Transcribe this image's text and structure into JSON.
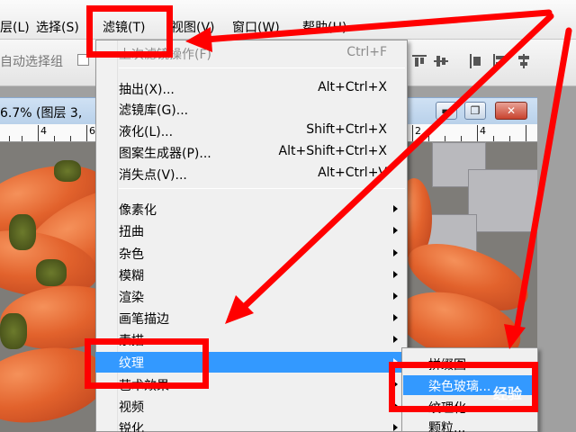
{
  "menubar": {
    "items": [
      "层(L)",
      "选择(S)",
      "滤镜(T)",
      "视图(V)",
      "窗口(W)",
      "帮助(H)"
    ]
  },
  "options_bar": {
    "auto_select_label": "自动选择组"
  },
  "document": {
    "title": "6.7% (图层 3,",
    "minimize_symbol": "▬",
    "restore_symbol": "❐",
    "close_symbol": "✕",
    "ruler_numbers": [
      "4",
      "6",
      "2",
      "4"
    ]
  },
  "filter_menu": {
    "items": [
      {
        "label": "上次滤镜操作(F)",
        "shortcut": "Ctrl+F",
        "disabled": true
      },
      {
        "label": "抽出(X)...",
        "shortcut": "Alt+Ctrl+X"
      },
      {
        "label": "滤镜库(G)...",
        "shortcut": ""
      },
      {
        "label": "液化(L)...",
        "shortcut": "Shift+Ctrl+X"
      },
      {
        "label": "图案生成器(P)...",
        "shortcut": "Alt+Shift+Ctrl+X"
      },
      {
        "label": "消失点(V)...",
        "shortcut": "Alt+Ctrl+V"
      },
      {
        "label": "像素化",
        "submenu": true
      },
      {
        "label": "扭曲",
        "submenu": true
      },
      {
        "label": "杂色",
        "submenu": true
      },
      {
        "label": "模糊",
        "submenu": true
      },
      {
        "label": "渲染",
        "submenu": true
      },
      {
        "label": "画笔描边",
        "submenu": true
      },
      {
        "label": "素描",
        "submenu": true
      },
      {
        "label": "纹理",
        "submenu": true,
        "highlighted": true
      },
      {
        "label": "艺术效果",
        "submenu": true
      },
      {
        "label": "视频",
        "submenu": true
      },
      {
        "label": "锐化",
        "submenu": true
      }
    ]
  },
  "texture_submenu": {
    "items": [
      {
        "label": "拼缀图"
      },
      {
        "label": "染色玻璃...",
        "highlighted": true
      },
      {
        "label": "纹理化..."
      },
      {
        "label": "颗粒..."
      }
    ]
  },
  "watermark": "经验",
  "colors": {
    "highlight": "#3399ff",
    "annotation": "#ff0000"
  }
}
